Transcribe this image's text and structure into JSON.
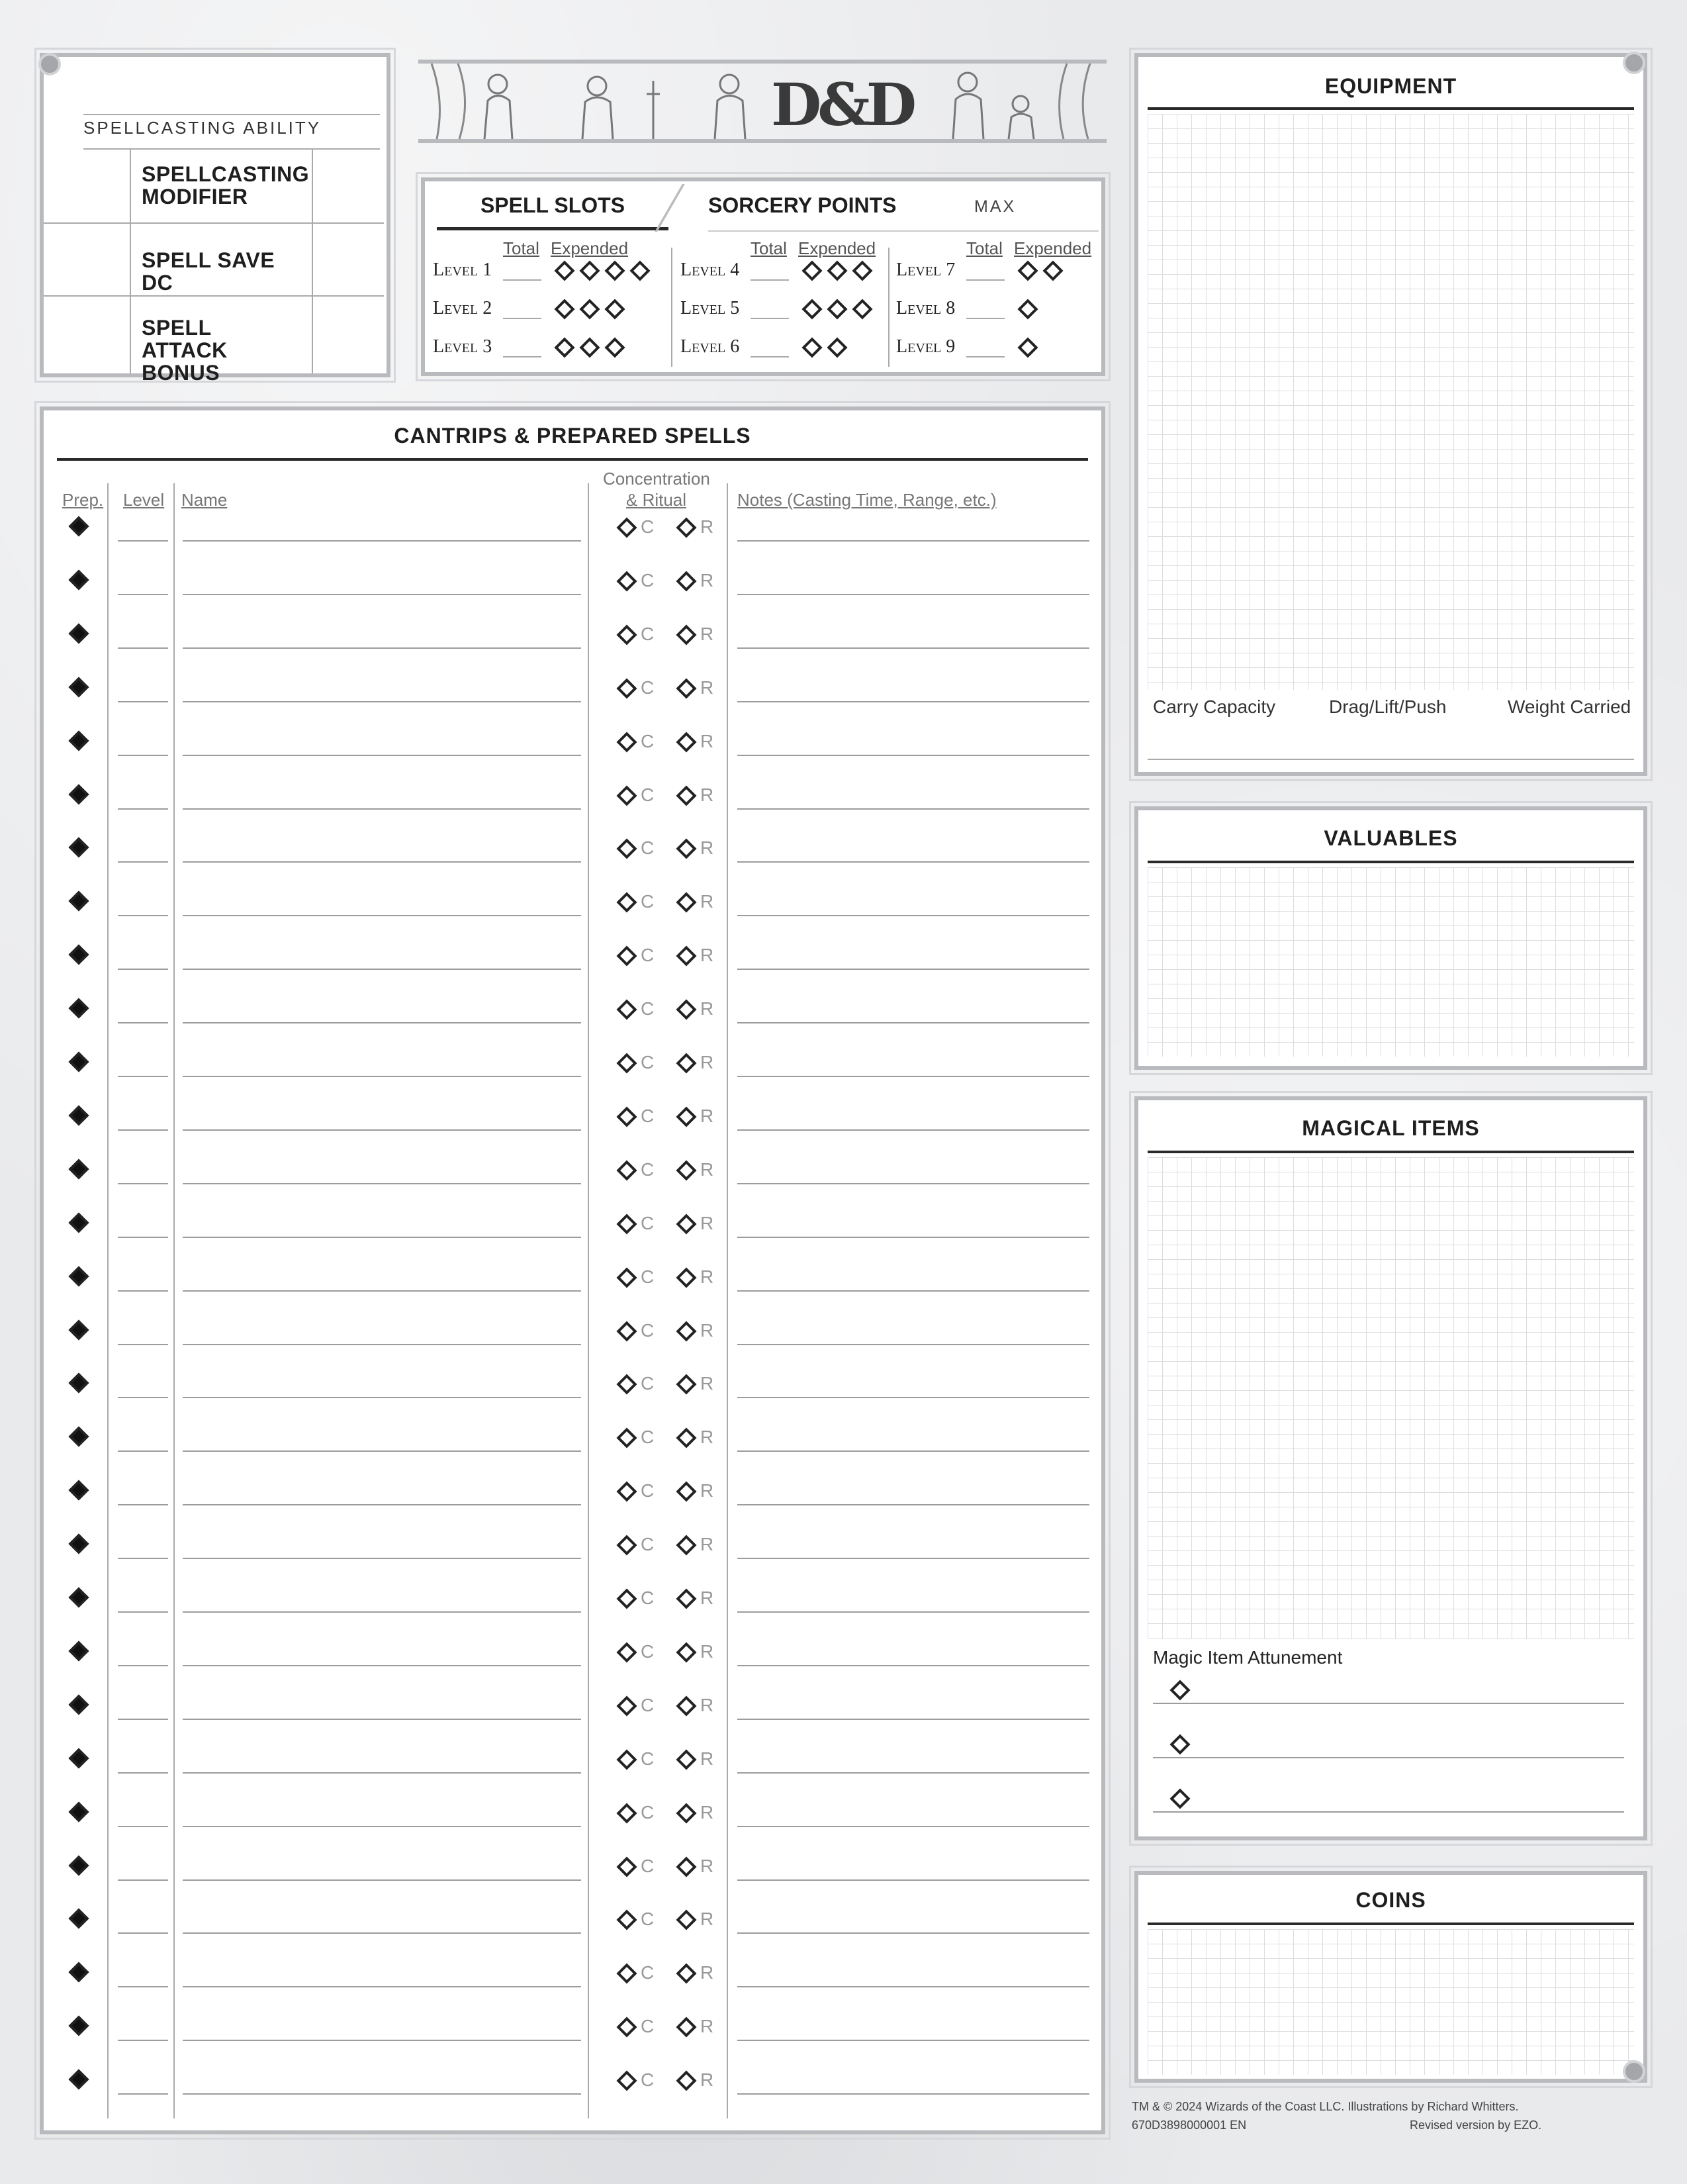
{
  "spellcasting": {
    "ability_label": "SPELLCASTING ABILITY",
    "modifier_label": "SPELLCASTING MODIFIER",
    "save_dc_label": "SPELL SAVE DC",
    "attack_bonus_label": "SPELL ATTACK BONUS"
  },
  "logo": {
    "text": "D&D"
  },
  "spell_slots": {
    "tab_label": "SPELL SLOTS",
    "sorcery_label": "SORCERY POINTS",
    "max_label": "MAX",
    "total_header": "Total",
    "expended_header": "Expended",
    "levels": [
      {
        "label": "Level 1",
        "slots": 4
      },
      {
        "label": "Level 2",
        "slots": 3
      },
      {
        "label": "Level 3",
        "slots": 3
      },
      {
        "label": "Level 4",
        "slots": 3
      },
      {
        "label": "Level 5",
        "slots": 3
      },
      {
        "label": "Level 6",
        "slots": 2
      },
      {
        "label": "Level 7",
        "slots": 2
      },
      {
        "label": "Level 8",
        "slots": 1
      },
      {
        "label": "Level 9",
        "slots": 1
      }
    ]
  },
  "spells": {
    "title": "CANTRIPS & PREPARED SPELLS",
    "headers": {
      "prep": "Prep.",
      "level": "Level",
      "name": "Name",
      "conc_line1": "Concentration",
      "conc_line2": "& Ritual",
      "notes": "Notes (Casting Time, Range, etc.)"
    },
    "concentration_letter": "C",
    "ritual_letter": "R",
    "row_count": 30
  },
  "equipment": {
    "title": "EQUIPMENT",
    "carry_capacity": "Carry Capacity",
    "drag_lift_push": "Drag/Lift/Push",
    "weight_carried": "Weight Carried"
  },
  "valuables": {
    "title": "VALUABLES"
  },
  "magical_items": {
    "title": "MAGICAL ITEMS",
    "attunement_label": "Magic Item Attunement",
    "attunement_slots": 3
  },
  "coins": {
    "title": "COINS"
  },
  "footer": {
    "copyright": "TM & © 2024 Wizards of the Coast LLC. Illustrations by Richard Whitters.",
    "product_code": "670D3898000001 EN",
    "revised": "Revised version by EZO."
  },
  "colors": {
    "border": "#b9babd",
    "ink": "#222222",
    "rule": "#2a2a2a"
  }
}
